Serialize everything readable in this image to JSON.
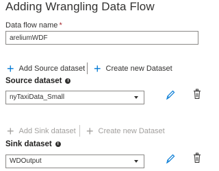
{
  "panel": {
    "title": "Adding Wrangling Data Flow"
  },
  "data_flow_name": {
    "label": "Data flow name",
    "required_marker": "*",
    "value": "areliumWDF"
  },
  "source": {
    "add_label": "Add Source dataset",
    "create_label": "Create new Dataset",
    "section_title": "Source dataset",
    "selected": "nyTaxiData_Small",
    "edit_icon": "pencil-icon",
    "delete_icon": "trash-icon"
  },
  "sink": {
    "add_label": "Add Sink dataset",
    "create_label": "Create new Dataset",
    "section_title": "Sink dataset",
    "selected": "WDOutput",
    "edit_icon": "pencil-icon",
    "delete_icon": "trash-icon",
    "actions_disabled": true
  },
  "colors": {
    "accent": "#0078d4",
    "required": "#a4262c",
    "disabled_text": "#a19f9d"
  }
}
